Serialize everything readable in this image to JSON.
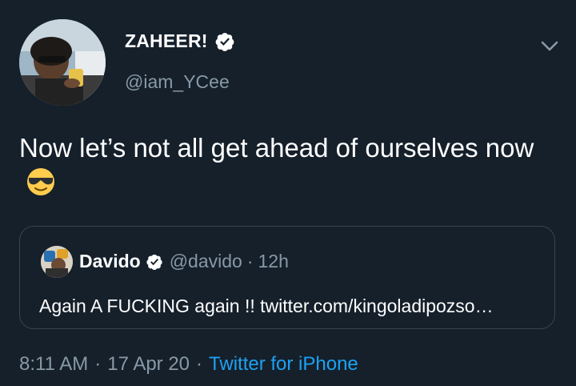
{
  "author": {
    "display_name": "ZAHEER!",
    "handle": "@iam_YCee",
    "verified": true
  },
  "tweet": {
    "text": "Now let’s not all get ahead of ourselves now",
    "emoji": "smiling-face-with-sunglasses"
  },
  "quoted": {
    "display_name": "Davido",
    "handle": "@davido",
    "separator": "·",
    "time": "12h",
    "text": "Again A FUCKING again !! twitter.com/kingoladipozso…",
    "verified": true
  },
  "meta": {
    "time": "8:11 AM",
    "date": "17 Apr 20",
    "separator": "·",
    "source": "Twitter for iPhone"
  },
  "colors": {
    "background": "#15202b",
    "text_primary": "#ffffff",
    "text_secondary": "#8899a6",
    "link": "#1da1f2",
    "border": "#38444d"
  }
}
